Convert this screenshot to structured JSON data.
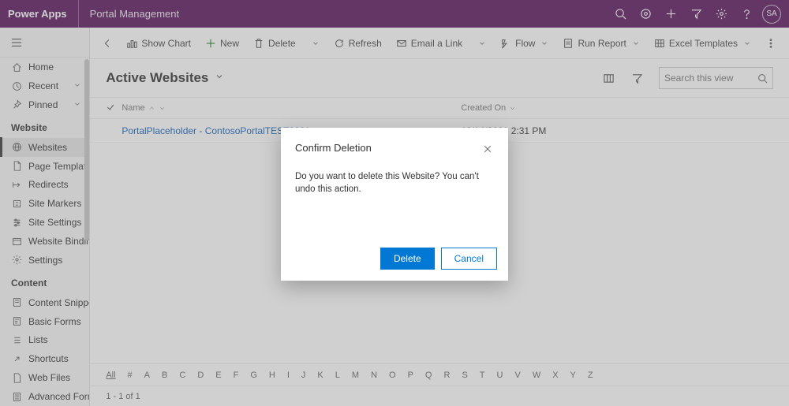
{
  "header": {
    "brand": "Power Apps",
    "app": "Portal Management",
    "user_initials": "SA"
  },
  "sidebar": {
    "top": [
      {
        "label": "Home"
      },
      {
        "label": "Recent",
        "expandable": true
      },
      {
        "label": "Pinned",
        "expandable": true
      }
    ],
    "section_website": "Website",
    "website_items": [
      {
        "label": "Websites",
        "active": true
      },
      {
        "label": "Page Templates"
      },
      {
        "label": "Redirects"
      },
      {
        "label": "Site Markers"
      },
      {
        "label": "Site Settings"
      },
      {
        "label": "Website Bindings"
      },
      {
        "label": "Settings"
      }
    ],
    "section_content": "Content",
    "content_items": [
      {
        "label": "Content Snippets"
      },
      {
        "label": "Basic Forms"
      },
      {
        "label": "Lists"
      },
      {
        "label": "Shortcuts"
      },
      {
        "label": "Web Files"
      },
      {
        "label": "Advanced Forms"
      }
    ]
  },
  "commands": {
    "show_chart": "Show Chart",
    "new": "New",
    "delete": "Delete",
    "refresh": "Refresh",
    "email_link": "Email a Link",
    "flow": "Flow",
    "run_report": "Run Report",
    "excel_templates": "Excel Templates"
  },
  "view": {
    "title": "Active Websites",
    "search_placeholder": "Search this view"
  },
  "grid": {
    "col_name": "Name",
    "col_created": "Created On",
    "rows": [
      {
        "name": "PortalPlaceholder - ContosoPortalTEST2021",
        "created": "12/14/2021 2:31 PM"
      }
    ],
    "alpha_all": "All",
    "alpha": [
      "#",
      "A",
      "B",
      "C",
      "D",
      "E",
      "F",
      "G",
      "H",
      "I",
      "J",
      "K",
      "L",
      "M",
      "N",
      "O",
      "P",
      "Q",
      "R",
      "S",
      "T",
      "U",
      "V",
      "W",
      "X",
      "Y",
      "Z"
    ],
    "footer": "1 - 1 of 1"
  },
  "dialog": {
    "title": "Confirm Deletion",
    "message": "Do you want to delete this Website? You can't undo this action.",
    "primary": "Delete",
    "secondary": "Cancel"
  }
}
